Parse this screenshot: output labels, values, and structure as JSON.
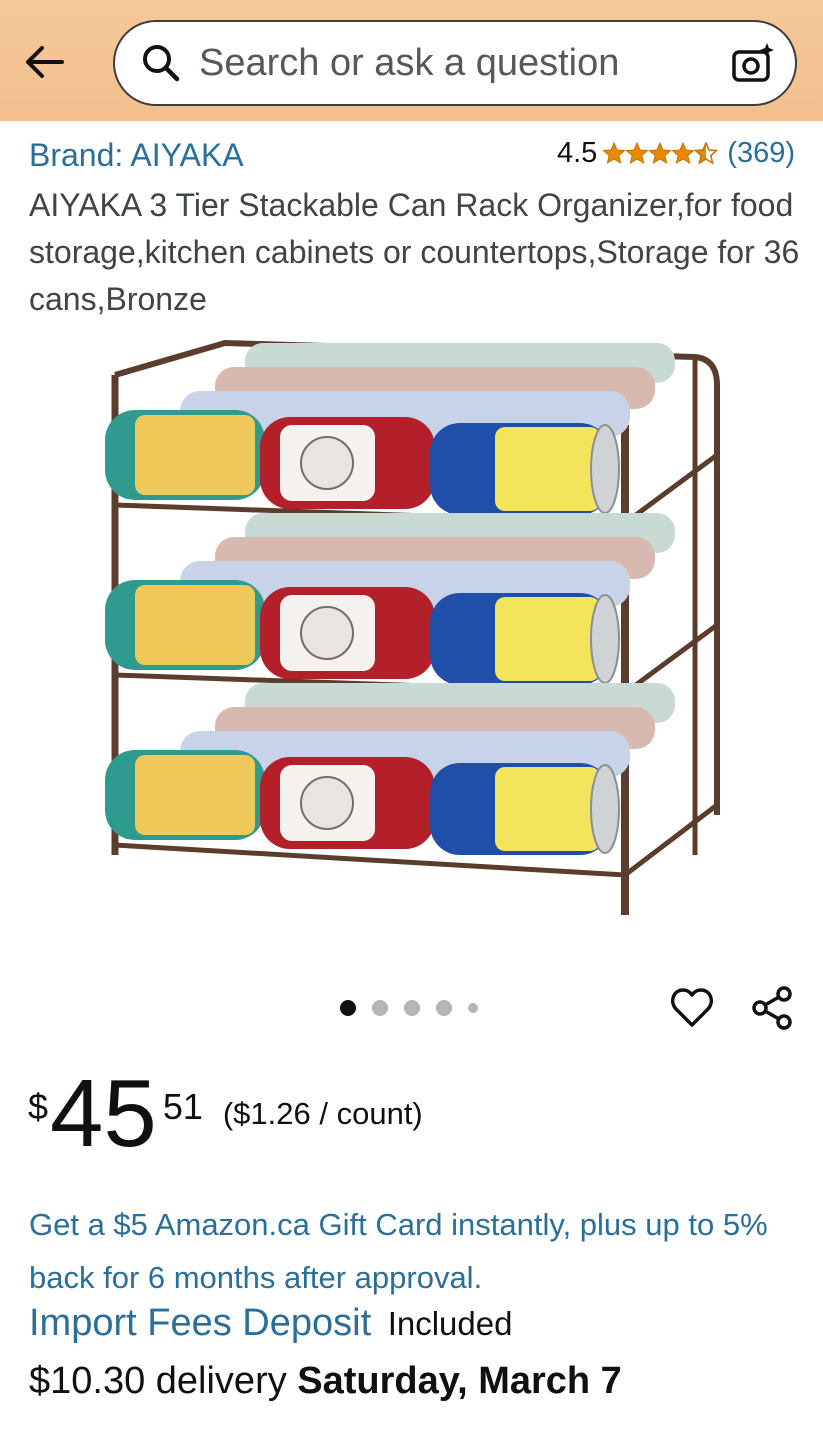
{
  "header": {
    "search_placeholder": "Search or ask a question",
    "back_icon": "arrow-left-icon",
    "camera_icon": "camera-sparkle-icon"
  },
  "product": {
    "brand": "Brand: AIYAKA",
    "rating": "4.5",
    "rating_value": 4.5,
    "rating_count": "(369)",
    "title": "AIYAKA 3 Tier Stackable Can Rack Organizer,for food storage,kitchen cabinets or countertops,Storage for 36 cans,Bronze",
    "image_count": 5,
    "active_image": 1
  },
  "price": {
    "currency": "$",
    "whole": "45",
    "fraction": "51",
    "unit_price": "($1.26 / count)"
  },
  "promo": "Get a $5 Amazon.ca Gift Card instantly, plus up to 5% back for 6 months after approval.",
  "import_fees": {
    "label": "Import Fees Deposit",
    "status": "Included"
  },
  "delivery": {
    "prefix": "$10.30 delivery",
    "date": "Saturday, March 7"
  },
  "colors": {
    "header_bg": "#f2bf8e",
    "link": "#2a6f97",
    "star": "#e88a00"
  }
}
